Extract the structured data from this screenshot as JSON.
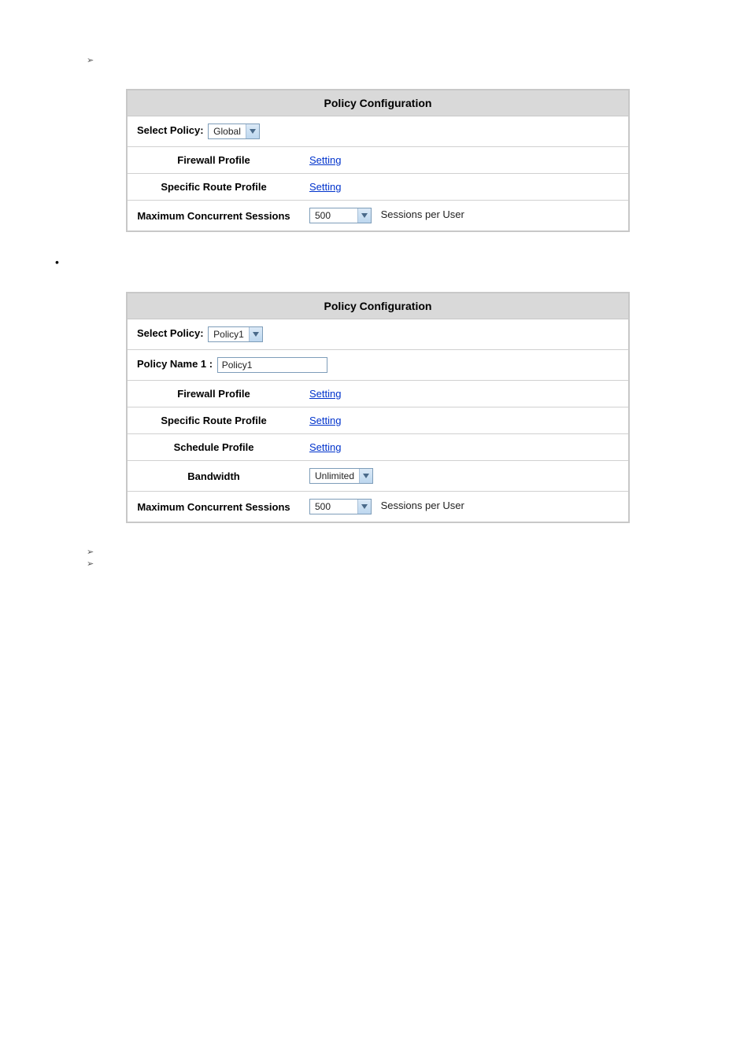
{
  "table1": {
    "title": "Policy Configuration",
    "select_policy_label": "Select Policy:",
    "select_policy_value": "Global",
    "rows": {
      "firewall_profile": {
        "label": "Firewall Profile",
        "link": "Setting"
      },
      "specific_route_profile": {
        "label": "Specific Route Profile",
        "link": "Setting"
      },
      "max_sessions": {
        "label": "Maximum Concurrent Sessions",
        "value": "500",
        "suffix": "Sessions per User"
      }
    }
  },
  "table2": {
    "title": "Policy Configuration",
    "select_policy_label": "Select Policy:",
    "select_policy_value": "Policy1",
    "policy_name_label": "Policy Name 1 :",
    "policy_name_value": "Policy1",
    "rows": {
      "firewall_profile": {
        "label": "Firewall Profile",
        "link": "Setting"
      },
      "specific_route_profile": {
        "label": "Specific Route Profile",
        "link": "Setting"
      },
      "schedule_profile": {
        "label": "Schedule Profile",
        "link": "Setting"
      },
      "bandwidth": {
        "label": "Bandwidth",
        "value": "Unlimited"
      },
      "max_sessions": {
        "label": "Maximum Concurrent Sessions",
        "value": "500",
        "suffix": "Sessions per User"
      }
    }
  },
  "bullets": {
    "arrow": "➢",
    "dot": "•"
  }
}
